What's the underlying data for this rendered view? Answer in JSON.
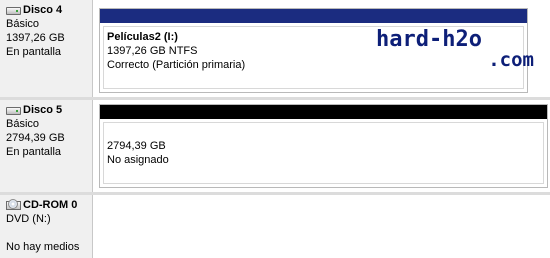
{
  "disks": [
    {
      "icon": "hard-disk-icon",
      "name": "Disco 4",
      "type": "Básico",
      "size": "1397,26 GB",
      "status": "En pantalla",
      "partition": {
        "bar_color": "#1b2c80",
        "title": "Películas2  (I:)",
        "size_fs": "1397,26 GB NTFS",
        "status": "Correcto (Partición primaria)"
      }
    },
    {
      "icon": "hard-disk-icon",
      "name": "Disco 5",
      "type": "Básico",
      "size": "2794,39 GB",
      "status": "En pantalla",
      "partition": {
        "bar_color": "#000000",
        "size": "2794,39 GB",
        "status": "No asignado"
      }
    }
  ],
  "cdrom": {
    "icon": "cd-rom-icon",
    "name": "CD-ROM 0",
    "drive": "DVD (N:)",
    "status": "No hay medios"
  },
  "watermark": {
    "main": "hard-h2o",
    "sub": ".com",
    "color": "#0d1f78"
  }
}
